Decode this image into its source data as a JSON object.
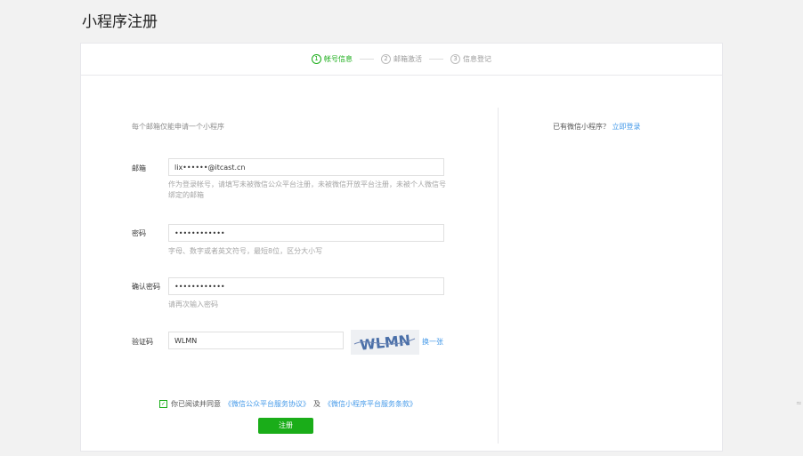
{
  "page": {
    "title": "小程序注册"
  },
  "steps": [
    {
      "number": "1",
      "label": "帐号信息",
      "active": true
    },
    {
      "number": "2",
      "label": "邮箱激活",
      "active": false
    },
    {
      "number": "3",
      "label": "信息登记",
      "active": false
    }
  ],
  "form": {
    "tip": "每个邮箱仅能申请一个小程序",
    "email": {
      "label": "邮箱",
      "value": "lix••••••@itcast.cn",
      "hint": "作为登录帐号，请填写未被微信公众平台注册，未被微信开放平台注册，未被个人微信号绑定的邮箱"
    },
    "password": {
      "label": "密码",
      "value": "••••••••••••",
      "hint": "字母、数字或者英文符号，最短8位，区分大小写"
    },
    "confirm_password": {
      "label": "确认密码",
      "value": "••••••••••••",
      "hint": "请再次输入密码"
    },
    "captcha": {
      "label": "验证码",
      "value": "WLMN",
      "image_text": "WLMN",
      "change_label": "换一张"
    },
    "agree": {
      "prefix": "你已阅读并同意",
      "link1": "《微信公众平台服务协议》",
      "and": "及",
      "link2": "《微信小程序平台服务条款》",
      "checked": true
    },
    "submit_label": "注册"
  },
  "side": {
    "text": "已有微信小程序？",
    "link": "立即登录"
  },
  "side_mark": "≈",
  "colors": {
    "accent": "#1aad19",
    "link": "#459ae9"
  }
}
